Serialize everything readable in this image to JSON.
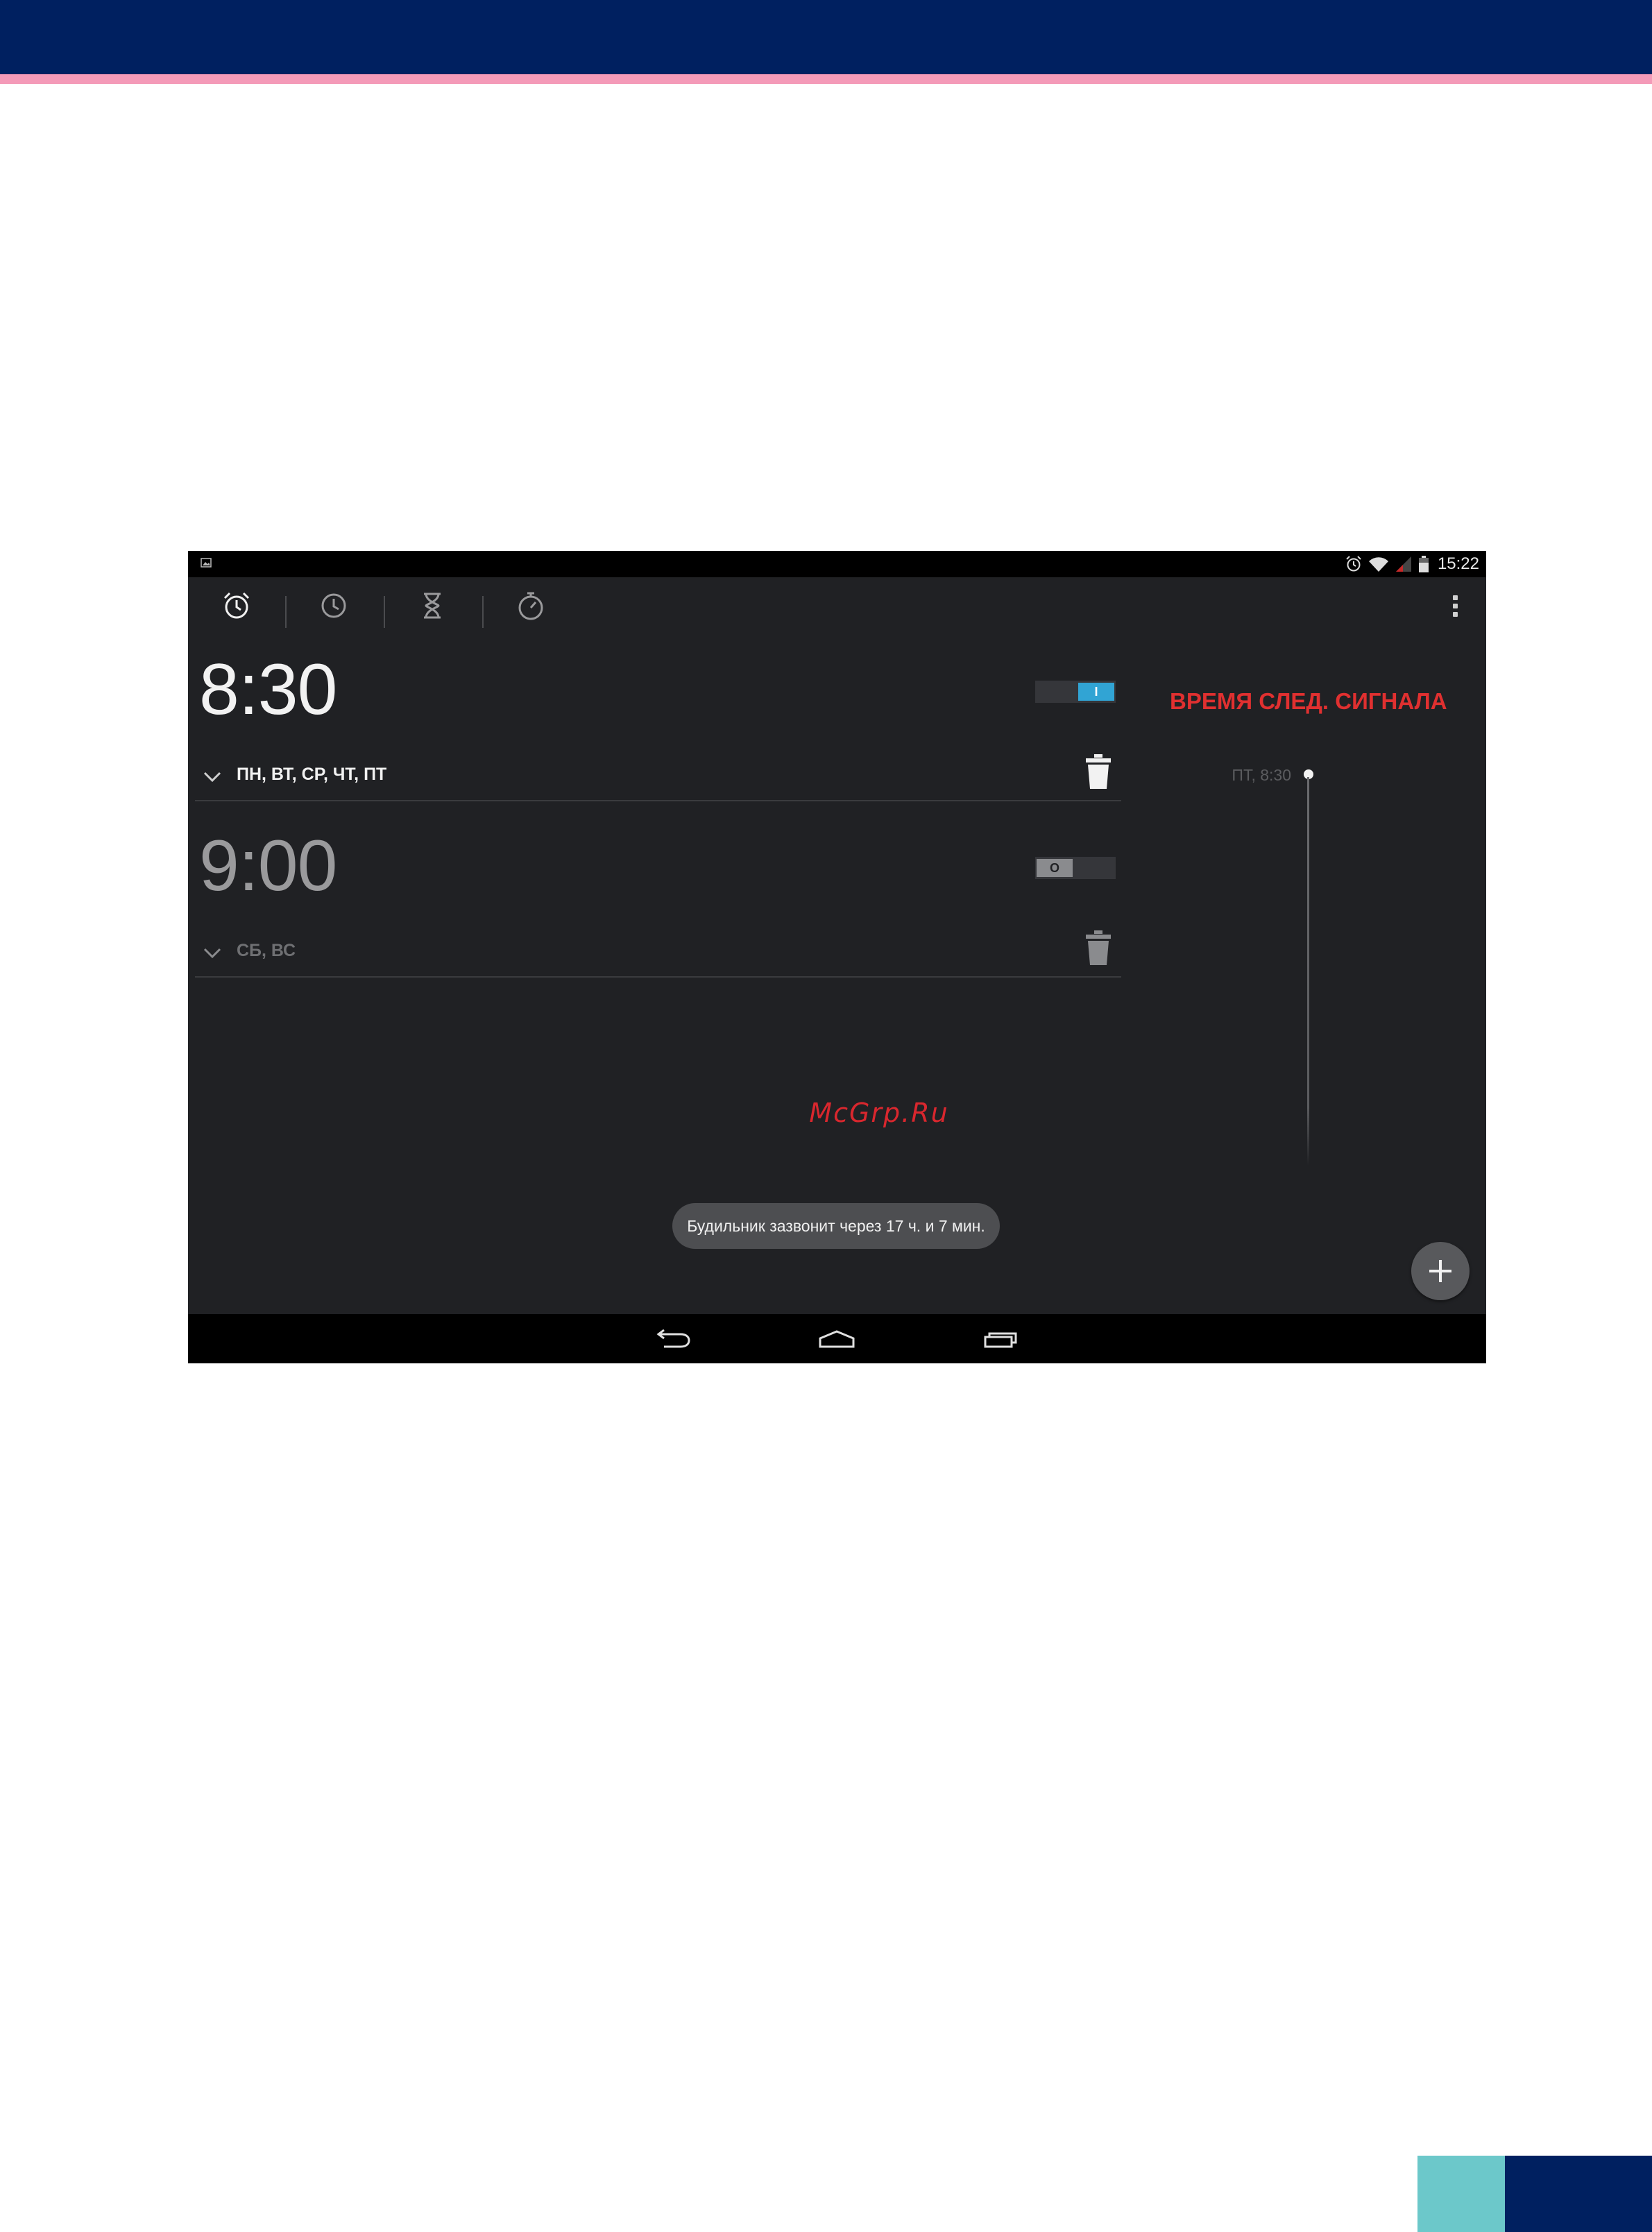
{
  "status_bar": {
    "time": "15:22",
    "icons": [
      "picture-notification-icon",
      "alarm-icon",
      "wifi-icon",
      "signal-icon",
      "battery-icon"
    ]
  },
  "tabs": [
    {
      "name": "alarm-tab",
      "icon": "alarm-clock-icon",
      "selected": true
    },
    {
      "name": "clock-tab",
      "icon": "clock-icon",
      "selected": false
    },
    {
      "name": "timer-tab",
      "icon": "hourglass-icon",
      "selected": false
    },
    {
      "name": "stopwatch-tab",
      "icon": "stopwatch-icon",
      "selected": false
    }
  ],
  "alarms": [
    {
      "time": "8:30",
      "days": "ПН, ВТ, СР, ЧТ, ПТ",
      "enabled": true,
      "toggle_glyph": "I"
    },
    {
      "time": "9:00",
      "days": "СБ, ВС",
      "enabled": false,
      "toggle_glyph": "O"
    }
  ],
  "next_alarm": {
    "heading": "ВРЕМЯ СЛЕД. СИГНАЛА",
    "entry": "ПТ, 8:30"
  },
  "watermark": "McGrp.Ru",
  "toast": "Будильник зазвонит через 17 ч. и 7 мин.",
  "colors": {
    "page_header": "#002060",
    "header_stripe": "#f49ab8",
    "footer_teal": "#6cc8ca",
    "app_background": "#202124",
    "toggle_on": "#31a4d4",
    "heading_red": "#e03030"
  }
}
